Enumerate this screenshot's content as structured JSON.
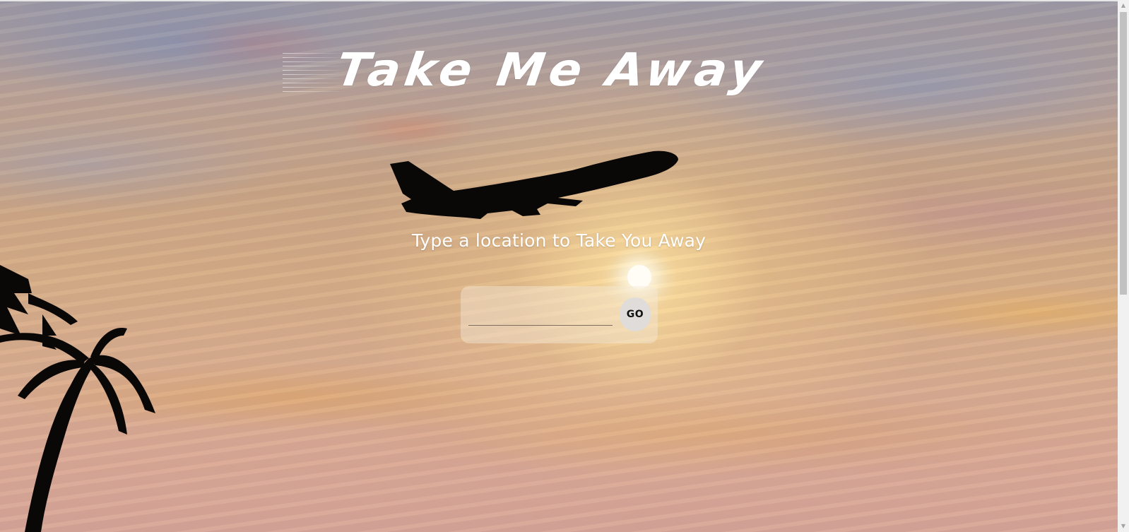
{
  "header": {
    "title": "Take Me Away"
  },
  "main": {
    "prompt": "Type a location to Take You Away",
    "search": {
      "value": "",
      "placeholder": ""
    },
    "go_label": "GO"
  },
  "icons": {
    "airplane": "airplane-silhouette",
    "palm": "palm-tree-silhouette",
    "sun": "sun-glow"
  },
  "colors": {
    "sky_top": "#9a97a4",
    "sky_bottom": "#d6a396",
    "title_text": "#ffffff",
    "button_bg": "#e0dcd9"
  }
}
